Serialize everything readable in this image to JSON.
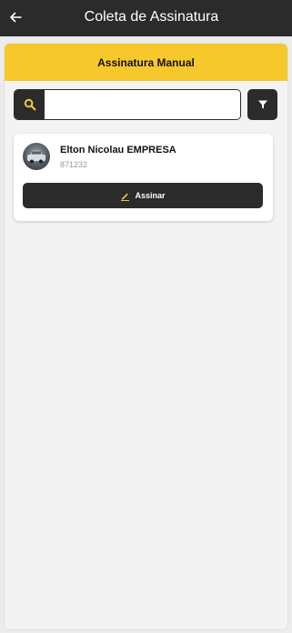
{
  "appbar": {
    "title": "Coleta de Assinatura",
    "back_icon": "arrow-left-icon"
  },
  "panel": {
    "header": "Assinatura Manual"
  },
  "search": {
    "icon": "search-icon",
    "value": "",
    "placeholder": ""
  },
  "filter": {
    "icon": "filter-icon"
  },
  "records": [
    {
      "name": "Elton Nicolau EMPRESA",
      "code": "871232",
      "action_label": "Assinar",
      "action_icon": "pencil-icon"
    }
  ],
  "colors": {
    "appbar": "#2b2b2b",
    "accent": "#f6c82b",
    "background": "#ececec"
  }
}
